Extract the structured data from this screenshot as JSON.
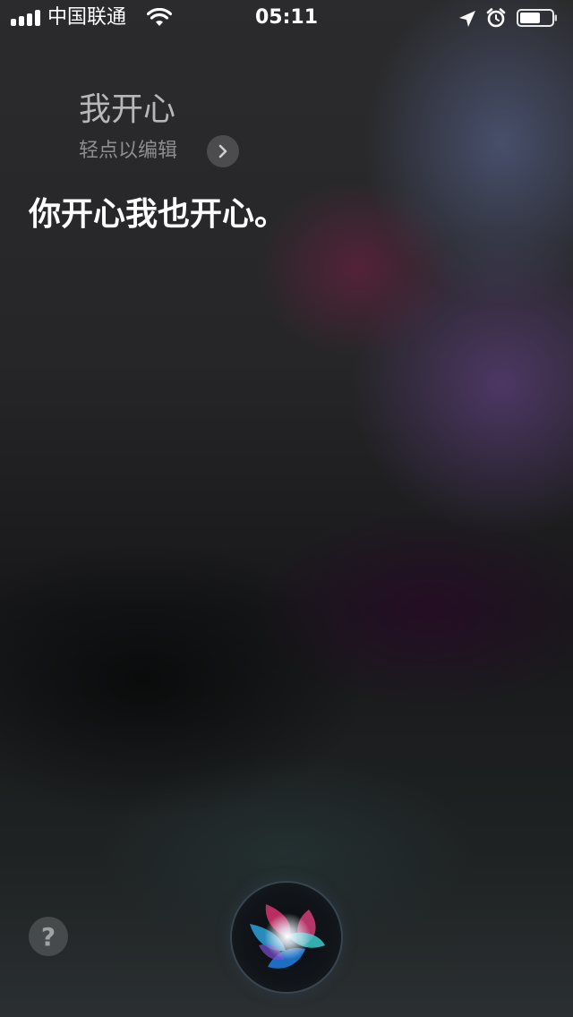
{
  "status_bar": {
    "carrier": "中国联通",
    "time": "05:11",
    "battery_level": 0.65,
    "signal_bars": 4
  },
  "siri": {
    "query": "我开心",
    "edit_hint": "轻点以编辑",
    "response": "你开心我也开心。",
    "help_label": "?"
  },
  "icons": {
    "signal": "signal-bars-icon",
    "wifi": "wifi-icon",
    "location": "location-arrow-icon",
    "alarm": "alarm-clock-icon",
    "battery": "battery-icon",
    "chevron": "chevron-right-icon",
    "help": "question-mark-icon",
    "siri": "siri-orb-icon"
  },
  "colors": {
    "text_primary": "#ffffff",
    "text_query": "#b7b7bb",
    "text_hint": "#8d8d92"
  }
}
